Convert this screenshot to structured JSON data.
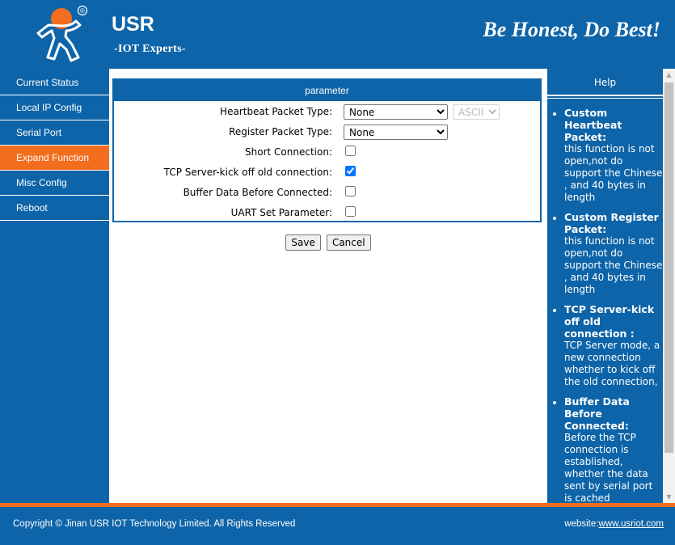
{
  "header": {
    "brand": "USR",
    "brand_sub": "-IOT Experts-",
    "registered": "®",
    "slogan": "Be Honest, Do Best!"
  },
  "sidebar": {
    "items": [
      {
        "label": "Current Status",
        "active": false
      },
      {
        "label": "Local IP Config",
        "active": false
      },
      {
        "label": "Serial Port",
        "active": false
      },
      {
        "label": "Expand Function",
        "active": true
      },
      {
        "label": "Misc Config",
        "active": false
      },
      {
        "label": "Reboot",
        "active": false
      }
    ]
  },
  "params": {
    "title": "parameter",
    "heartbeat_label": "Heartbeat Packet Type:",
    "heartbeat_value": "None",
    "heartbeat_format": "ASCII",
    "register_label": "Register Packet Type:",
    "register_value": "None",
    "short_conn_label": "Short Connection:",
    "kick_label": "TCP Server-kick off old connection:",
    "buffer_label": "Buffer Data Before Connected:",
    "uart_label": "UART Set Parameter:",
    "short_conn_checked": false,
    "kick_checked": true,
    "buffer_checked": false,
    "uart_checked": false
  },
  "buttons": {
    "save": "Save",
    "cancel": "Cancel"
  },
  "help": {
    "title": "Help",
    "items": [
      {
        "heading": "Custom Heartbeat Packet:",
        "text": "this function is not open,not do support the Chinese , and 40 bytes in length"
      },
      {
        "heading": "Custom Register Packet:",
        "text": "this function is not open,not do support the Chinese , and 40 bytes in length"
      },
      {
        "heading": "TCP Server-kick off old connection :",
        "text": "TCP Server mode, a new connection whether to kick off the old connection,"
      },
      {
        "heading": "Buffer Data Before Connected:",
        "text": "Before the TCP connection is established, whether the data sent by serial port is cached"
      }
    ]
  },
  "footer": {
    "copyright": "Copyright © Jinan USR IOT Technology Limited. All Rights Reserved",
    "website_label": "website:",
    "website_link": "www.usriot.com"
  },
  "colors": {
    "primary": "#0e64a8",
    "accent": "#f36d1e"
  },
  "icons": {
    "logo": "usr-person-logo-icon"
  }
}
